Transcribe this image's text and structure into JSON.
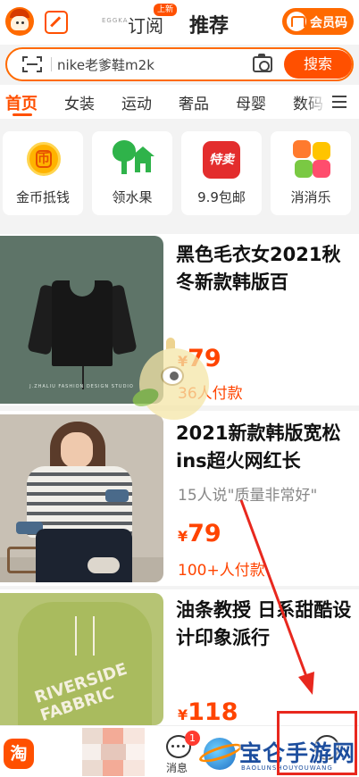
{
  "header": {
    "brand_small": "EGGKA",
    "subscribe_label": "订阅",
    "new_badge": "上新",
    "recommend_label": "推荐",
    "vip_label": "会员码"
  },
  "search": {
    "value": "nike老爹鞋m2k",
    "button": "搜索"
  },
  "categories": [
    "首页",
    "女装",
    "运动",
    "奢品",
    "母婴",
    "数码"
  ],
  "tiles": [
    {
      "label": "金币抵钱",
      "icon": "coin-icon"
    },
    {
      "label": "领水果",
      "icon": "tree-house-icon"
    },
    {
      "label": "9.9包邮",
      "icon": "tejia-icon",
      "icon_text": "特卖"
    },
    {
      "label": "消消乐",
      "icon": "match-game-icon"
    }
  ],
  "products": [
    {
      "title": "黑色毛衣女2021秋冬新款韩版百",
      "currency": "¥",
      "price": "79",
      "buyers": "36人付款",
      "image_caption": "J.ZHALIU  FASHION DESIGN STUDIO"
    },
    {
      "title": "2021新款韩版宽松ins超火网红长",
      "quote": "15人说\"质量非常好\"",
      "currency": "¥",
      "price": "79",
      "buyers": "100+人付款"
    },
    {
      "title": "油条教授 日系甜酷设计印象派行",
      "currency": "¥",
      "price": "118",
      "image_caption": "RIVERSIDE FABBRIC"
    }
  ],
  "bottom_nav": {
    "home_icon_text": "淘",
    "message_label": "消息",
    "message_badge": "1"
  },
  "watermark": {
    "title": "宝仑手游网",
    "subtitle": "BAOLUNSHOUYOUWANG"
  },
  "colors": {
    "accent": "#ff5000",
    "price": "#ff4400",
    "annotation": "#e8281e"
  }
}
